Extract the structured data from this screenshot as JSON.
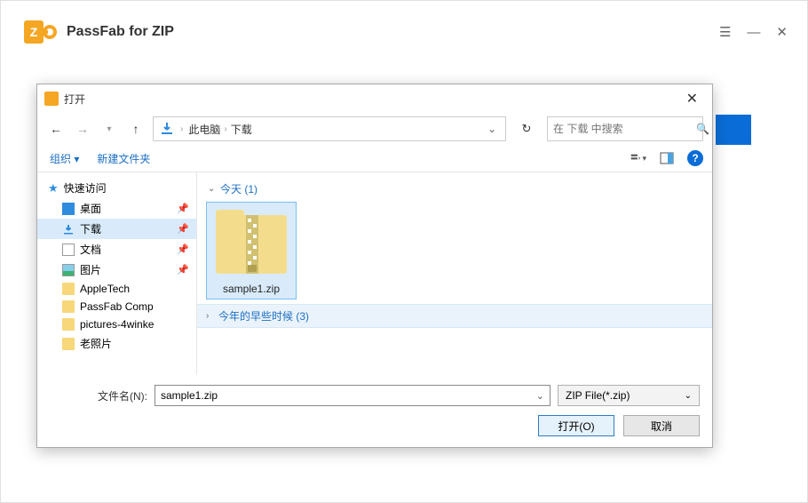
{
  "app": {
    "title": "PassFab for ZIP"
  },
  "dialog": {
    "title": "打开",
    "breadcrumb": {
      "root": "此电脑",
      "folder": "下载"
    },
    "search_placeholder": "在 下载 中搜索",
    "toolbar": {
      "organize": "组织",
      "new_folder": "新建文件夹"
    },
    "sidebar": {
      "quick_access": "快速访问",
      "items": [
        {
          "label": "桌面"
        },
        {
          "label": "下载"
        },
        {
          "label": "文档"
        },
        {
          "label": "图片"
        }
      ],
      "folders": [
        {
          "label": "AppleTech"
        },
        {
          "label": "PassFab Comp"
        },
        {
          "label": "pictures-4winke"
        },
        {
          "label": "老照片"
        }
      ]
    },
    "content": {
      "group_today": "今天 (1)",
      "file_selected": "sample1.zip",
      "group_earlier": "今年的早些时候 (3)"
    },
    "footer": {
      "filename_label": "文件名(N):",
      "filename_value": "sample1.zip",
      "filetype_value": "ZIP File(*.zip)",
      "open_btn": "打开(O)",
      "cancel_btn": "取消"
    }
  }
}
